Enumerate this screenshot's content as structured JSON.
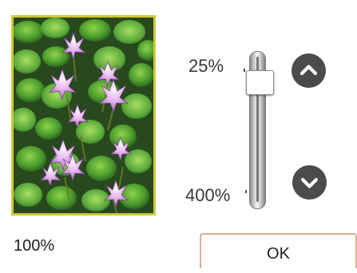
{
  "zoom": {
    "max_label": "25%",
    "min_label": "400%",
    "current_label": "100%"
  },
  "controls": {
    "ok_label": "OK",
    "up_icon": "chevron-up-icon",
    "down_icon": "chevron-down-icon"
  },
  "colors": {
    "preview_border": "#cfc83a",
    "ok_border": "#dcae92",
    "arrow_button": "#4b4b4b"
  }
}
